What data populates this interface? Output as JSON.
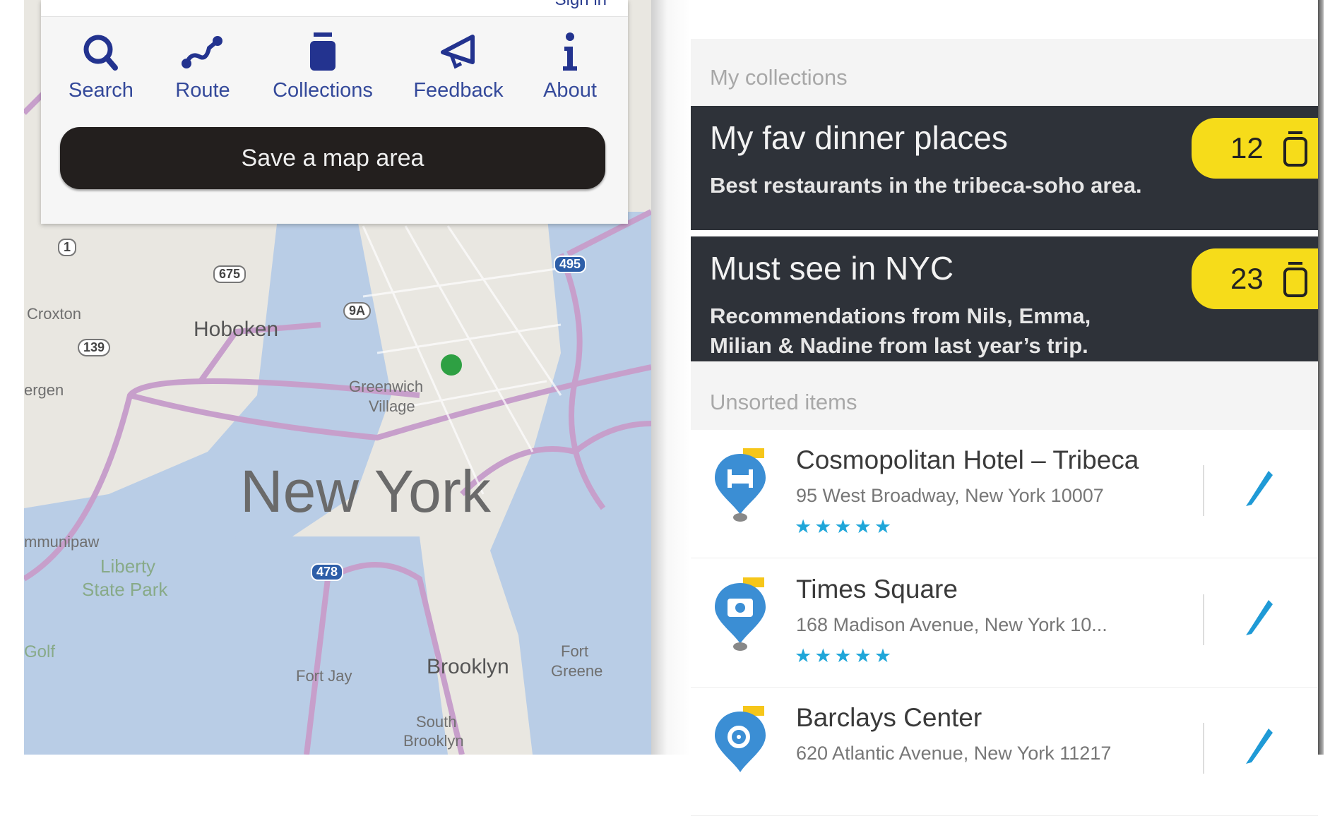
{
  "map": {
    "labels": {
      "city": "New York",
      "hoboken": "Hoboken",
      "greenwich": "Greenwich",
      "village": "Village",
      "liberty": "Liberty",
      "statepark": "State Park",
      "brooklyn": "Brooklyn",
      "fortjay": "Fort Jay",
      "fort": "Fort",
      "greene": "Greene",
      "south": "South",
      "sbrooklyn": "Brooklyn",
      "croxton": "Croxton",
      "bergen": "ergen",
      "communipaw": "mmunipaw",
      "golf": "Golf"
    },
    "shields": [
      "1",
      "675",
      "139",
      "9A",
      "495",
      "478"
    ],
    "colors": {
      "land": "#e9e7e1",
      "water": "#b9cde6",
      "road": "#c79fcb",
      "location": "#2ea043"
    }
  },
  "panel": {
    "signin": "Sign in",
    "nav": [
      {
        "label": "Search",
        "icon": "search-icon"
      },
      {
        "label": "Route",
        "icon": "route-icon"
      },
      {
        "label": "Collections",
        "icon": "collections-icon"
      },
      {
        "label": "Feedback",
        "icon": "feedback-icon"
      },
      {
        "label": "About",
        "icon": "info-icon"
      }
    ],
    "save_button": "Save a map area"
  },
  "collections": {
    "header": "My collections",
    "items": [
      {
        "title": "My fav dinner places",
        "description": "Best restaurants in the tribeca-soho area.",
        "count": "12"
      },
      {
        "title": "Must see in NYC",
        "description": "Recommendations from Nils, Emma, Milian & Nadine from last year’s trip.",
        "count": "23"
      }
    ],
    "badge_color": "#f6dc1a"
  },
  "unsorted": {
    "header": "Unsorted items",
    "items": [
      {
        "name": "Cosmopolitan Hotel – Tribeca",
        "address": "95 West Broadway, New York 10007",
        "rating": 5,
        "stars": "★★★★★",
        "icon": "hotel-icon"
      },
      {
        "name": "Times Square",
        "address": "168 Madison Avenue, New York 10...",
        "rating": 5,
        "stars": "★★★★★",
        "icon": "camera-icon"
      },
      {
        "name": "Barclays Center",
        "address": "620 Atlantic Avenue, New York 11217",
        "icon": "stadium-icon"
      }
    ]
  }
}
